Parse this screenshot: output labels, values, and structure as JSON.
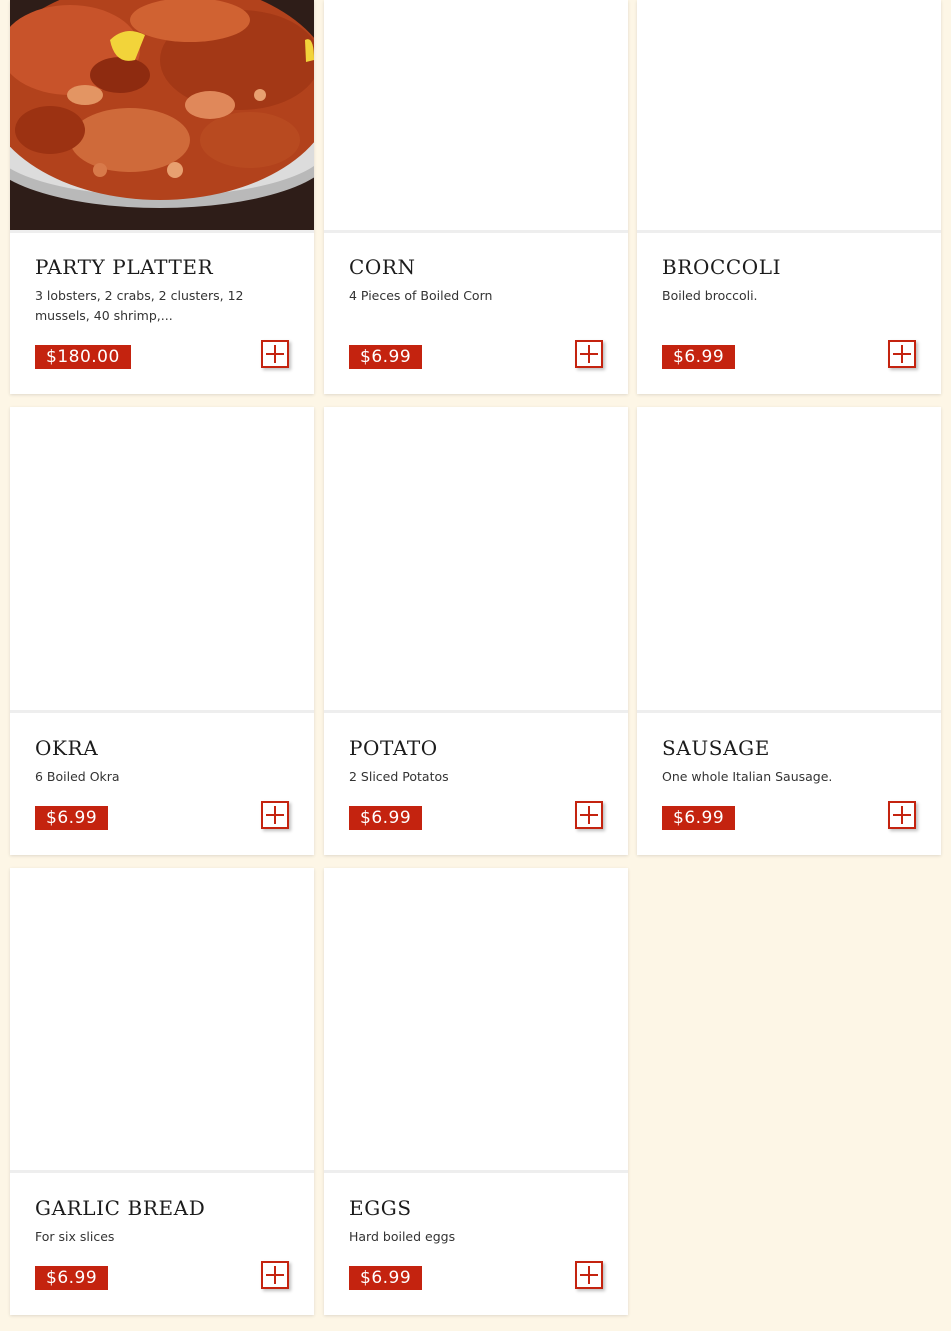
{
  "menu": {
    "items": [
      {
        "name": "PARTY PLATTER",
        "description": "3 lobsters, 2 crabs, 2 clusters, 12 mussels, 40 shrimp,...",
        "price": "$180.00",
        "add_label": "+",
        "image": "seafood-boil-photo"
      },
      {
        "name": "CORN",
        "description": "4 Pieces of Boiled Corn",
        "price": "$6.99",
        "add_label": "+",
        "image": "blank"
      },
      {
        "name": "BROCCOLI",
        "description": "Boiled broccoli.",
        "price": "$6.99",
        "add_label": "+",
        "image": "blank"
      },
      {
        "name": "OKRA",
        "description": "6 Boiled Okra",
        "price": "$6.99",
        "add_label": "+",
        "image": "blank"
      },
      {
        "name": "POTATO",
        "description": "2 Sliced Potatos",
        "price": "$6.99",
        "add_label": "+",
        "image": "blank"
      },
      {
        "name": "SAUSAGE",
        "description": "One whole Italian Sausage.",
        "price": "$6.99",
        "add_label": "+",
        "image": "blank"
      },
      {
        "name": "GARLIC BREAD",
        "description": "For six slices",
        "price": "$6.99",
        "add_label": "+",
        "image": "blank"
      },
      {
        "name": "EGGS",
        "description": "Hard boiled eggs",
        "price": "$6.99",
        "add_label": "+",
        "image": "blank"
      }
    ]
  },
  "colors": {
    "page_background": "#fdf6e6",
    "accent": "#c4230f",
    "card_background": "#ffffff"
  },
  "icons": {
    "add": "plus-icon"
  }
}
